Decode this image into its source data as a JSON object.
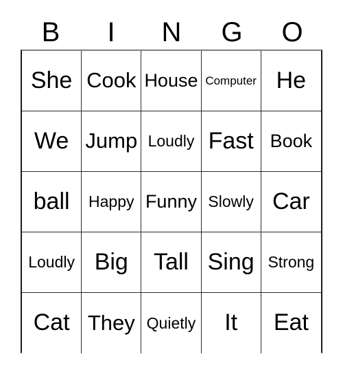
{
  "card": {
    "title": "BINGO",
    "header_letters": [
      "B",
      "I",
      "N",
      "G",
      "O"
    ],
    "colors": {
      "background": "#ffffff",
      "text": "#000000",
      "grid_line": "#2b2b2b",
      "outer_border": "#808080"
    },
    "grid": {
      "columns": 5,
      "rows": 5,
      "cells": [
        [
          {
            "label": "She",
            "size": "xl"
          },
          {
            "label": "Cook",
            "size": "lg"
          },
          {
            "label": "House",
            "size": "md"
          },
          {
            "label": "Computer",
            "size": "xs"
          },
          {
            "label": "He",
            "size": "xl"
          }
        ],
        [
          {
            "label": "We",
            "size": "xl"
          },
          {
            "label": "Jump",
            "size": "lg"
          },
          {
            "label": "Loudly",
            "size": "sm"
          },
          {
            "label": "Fast",
            "size": "xl"
          },
          {
            "label": "Book",
            "size": "md"
          }
        ],
        [
          {
            "label": "ball",
            "size": "xl"
          },
          {
            "label": "Happy",
            "size": "sm"
          },
          {
            "label": "Funny",
            "size": "md"
          },
          {
            "label": "Slowly",
            "size": "sm"
          },
          {
            "label": "Car",
            "size": "xl"
          }
        ],
        [
          {
            "label": "Loudly",
            "size": "sm"
          },
          {
            "label": "Big",
            "size": "xl"
          },
          {
            "label": "Tall",
            "size": "xl"
          },
          {
            "label": "Sing",
            "size": "xl"
          },
          {
            "label": "Strong",
            "size": "sm"
          }
        ],
        [
          {
            "label": "Cat",
            "size": "xl"
          },
          {
            "label": "They",
            "size": "lg"
          },
          {
            "label": "Quietly",
            "size": "sm"
          },
          {
            "label": "It",
            "size": "xl"
          },
          {
            "label": "Eat",
            "size": "xl"
          }
        ]
      ]
    }
  }
}
